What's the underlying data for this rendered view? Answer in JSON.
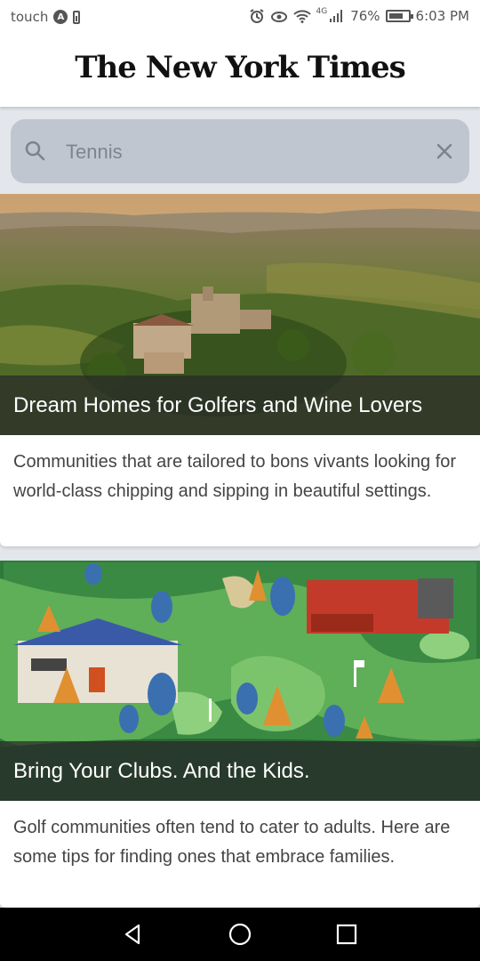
{
  "status_bar": {
    "carrier": "touch",
    "network": "4G",
    "battery": "76%",
    "time": "6:03 PM"
  },
  "header": {
    "logo": "The New York Times"
  },
  "search": {
    "value": "Tennis",
    "placeholder": "Search"
  },
  "articles": [
    {
      "title": "Dream Homes for Golfers and Wine Lovers",
      "description": "Communities that are tailored to bons vivants looking for world-class chipping and sipping in beautiful settings."
    },
    {
      "title": "Bring Your Clubs. And the Kids.",
      "description": "Golf communities often tend to cater to adults. Here are some tips for finding ones that embrace families."
    }
  ],
  "colors": {
    "search_bg": "#bfc6d0",
    "page_bg": "#e3e6ea",
    "title_overlay": "#2b2b2b"
  }
}
